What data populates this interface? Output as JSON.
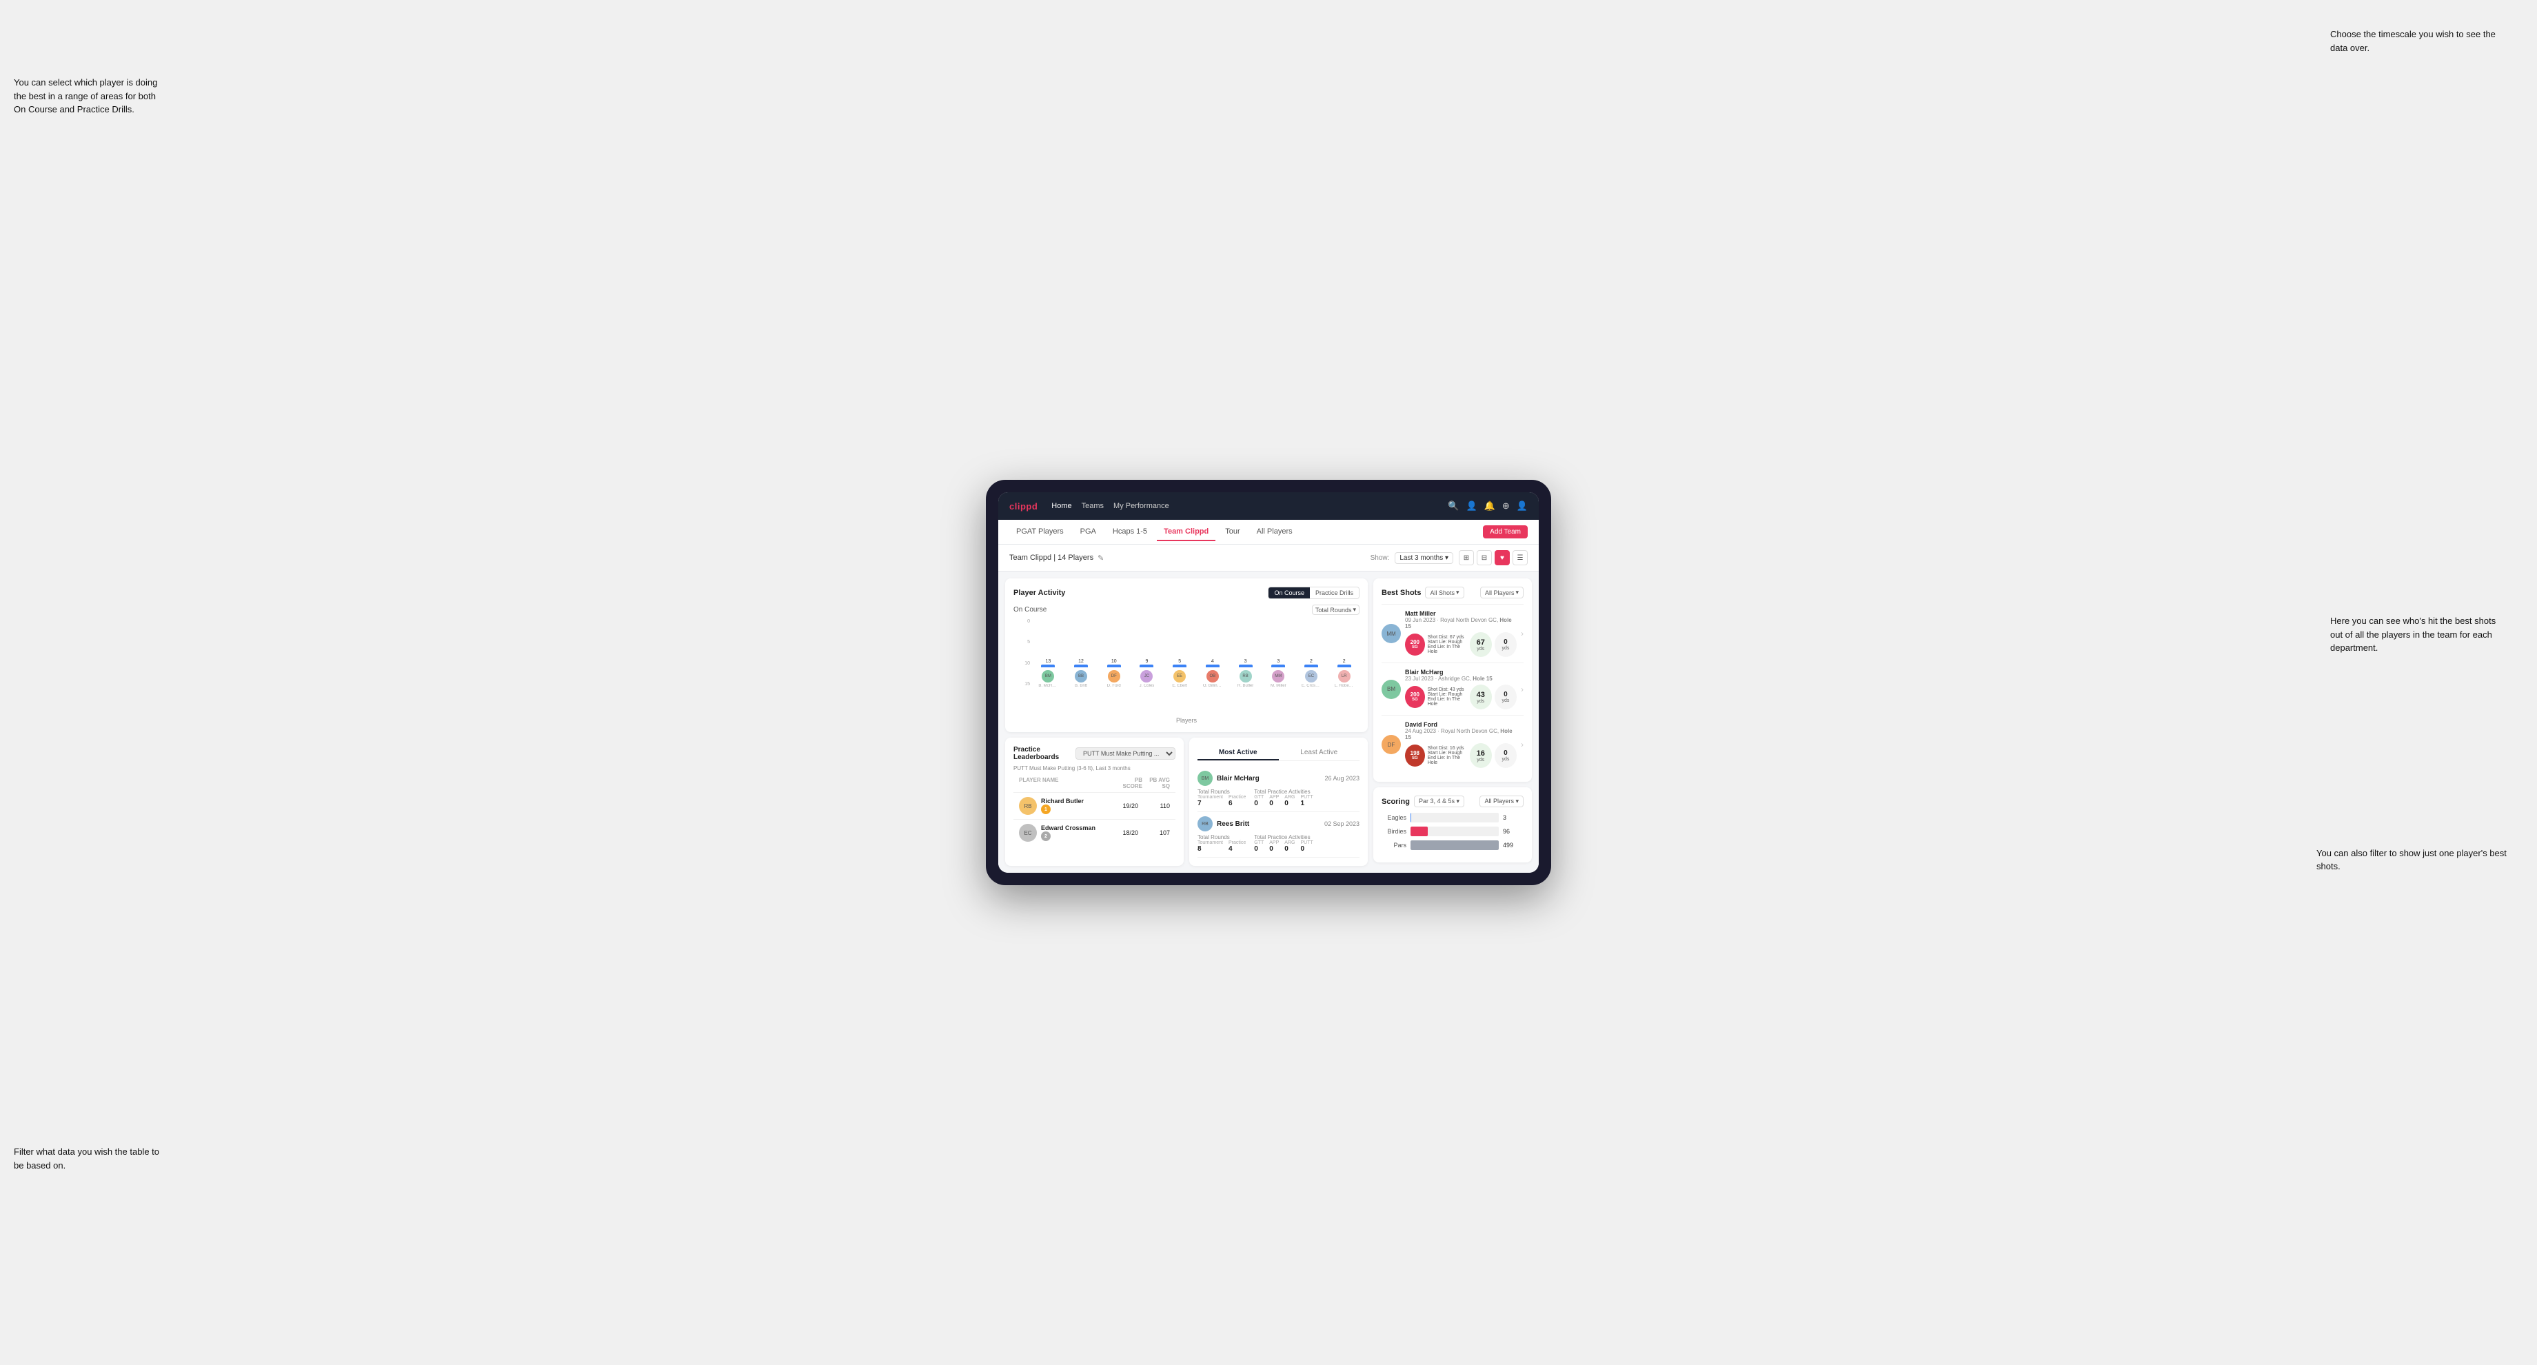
{
  "annotations": {
    "top_right": "Choose the timescale you\nwish to see the data over.",
    "top_left_title": "You can select which player is\ndoing the best in a range of\nareas for both On Course and\nPractice Drills.",
    "bottom_left": "Filter what data you wish the\ntable to be based on.",
    "right_mid": "Here you can see who's hit\nthe best shots out of all the\nplayers in the team for\neach department.",
    "right_bottom": "You can also filter to show\njust one player's best shots."
  },
  "nav": {
    "logo": "clippd",
    "links": [
      "Home",
      "Teams",
      "My Performance"
    ],
    "icons": [
      "search",
      "person",
      "bell",
      "add",
      "user"
    ]
  },
  "sub_nav": {
    "tabs": [
      "PGAT Players",
      "PGA",
      "Hcaps 1-5",
      "Team Clippd",
      "Tour",
      "All Players"
    ],
    "active": "Team Clippd",
    "add_button": "Add Team"
  },
  "team_header": {
    "title": "Team Clippd | 14 Players",
    "edit_icon": "✎",
    "show_label": "Show:",
    "time_select": "Last 3 months",
    "view_icons": [
      "grid",
      "grid2",
      "heart",
      "list"
    ]
  },
  "player_activity": {
    "title": "Player Activity",
    "toggle": [
      "On Course",
      "Practice Drills"
    ],
    "active_toggle": "On Course",
    "section_label": "On Course",
    "chart_dropdown": "Total Rounds",
    "y_labels": [
      "0",
      "5",
      "10",
      "15"
    ],
    "x_title": "Players",
    "y_title": "Total Rounds",
    "bars": [
      {
        "name": "B. McHarg",
        "value": 13,
        "initials": "BM"
      },
      {
        "name": "B. Britt",
        "value": 12,
        "initials": "BB"
      },
      {
        "name": "D. Ford",
        "value": 10,
        "initials": "DF"
      },
      {
        "name": "J. Coles",
        "value": 9,
        "initials": "JC"
      },
      {
        "name": "E. Ebert",
        "value": 5,
        "initials": "EE"
      },
      {
        "name": "O. Billingham",
        "value": 4,
        "initials": "OB"
      },
      {
        "name": "R. Butler",
        "value": 3,
        "initials": "RB"
      },
      {
        "name": "M. Miller",
        "value": 3,
        "initials": "MM"
      },
      {
        "name": "E. Crossman",
        "value": 2,
        "initials": "EC"
      },
      {
        "name": "L. Robertson",
        "value": 2,
        "initials": "LR"
      }
    ]
  },
  "practice_leaderboards": {
    "title": "Practice Leaderboards",
    "dropdown": "PUTT Must Make Putting ...",
    "subtitle": "PUTT Must Make Putting (3-6 ft), Last 3 months",
    "columns": [
      "PLAYER NAME",
      "PB SCORE",
      "PB AVG SQ"
    ],
    "players": [
      {
        "name": "Richard Butler",
        "rank": 1,
        "score": "19/20",
        "avg": "110",
        "initials": "RB"
      },
      {
        "name": "Edward Crossman",
        "rank": 2,
        "score": "18/20",
        "avg": "107",
        "initials": "EC"
      }
    ]
  },
  "most_active": {
    "tabs": [
      "Most Active",
      "Least Active"
    ],
    "active_tab": "Most Active",
    "players": [
      {
        "name": "Blair McHarg",
        "date": "26 Aug 2023",
        "total_rounds_label": "Total Rounds",
        "tournament": "7",
        "practice": "6",
        "total_practice_label": "Total Practice Activities",
        "gtt": "0",
        "app": "0",
        "arg": "0",
        "putt": "1"
      },
      {
        "name": "Rees Britt",
        "date": "02 Sep 2023",
        "total_rounds_label": "Total Rounds",
        "tournament": "8",
        "practice": "4",
        "total_practice_label": "Total Practice Activities",
        "gtt": "0",
        "app": "0",
        "arg": "0",
        "putt": "0"
      }
    ]
  },
  "best_shots": {
    "title": "Best Shots",
    "filter_shots": "All Shots",
    "filter_players": "All Players",
    "players": [
      {
        "name": "Matt Miller",
        "date": "09 Jun 2023",
        "course": "Royal North Devon GC",
        "hole": "Hole 15",
        "badge": "200",
        "badge_sub": "SG",
        "shot_dist_text": "Shot Dist: 67 yds\nStart Lie: Rough\nEnd Lie: In The Hole",
        "dist_val": "67",
        "dist_label": "yds",
        "zero_val": "0",
        "zero_label": "yds",
        "initials": "MM"
      },
      {
        "name": "Blair McHarg",
        "date": "23 Jul 2023",
        "course": "Ashridge GC",
        "hole": "Hole 15",
        "badge": "200",
        "badge_sub": "SG",
        "shot_dist_text": "Shot Dist: 43 yds\nStart Lie: Rough\nEnd Lie: In The Hole",
        "dist_val": "43",
        "dist_label": "yds",
        "zero_val": "0",
        "zero_label": "yds",
        "initials": "BM"
      },
      {
        "name": "David Ford",
        "date": "24 Aug 2023",
        "course": "Royal North Devon GC",
        "hole": "Hole 15",
        "badge": "198",
        "badge_sub": "SG",
        "shot_dist_text": "Shot Dist: 16 yds\nStart Lie: Rough\nEnd Lie: In The Hole",
        "dist_val": "16",
        "dist_label": "yds",
        "zero_val": "0",
        "zero_label": "yds",
        "initials": "DF"
      }
    ]
  },
  "scoring": {
    "title": "Scoring",
    "filter_par": "Par 3, 4 & 5s",
    "filter_players": "All Players",
    "bars": [
      {
        "label": "Eagles",
        "value": 3,
        "max": 500,
        "color": "#3b82f6"
      },
      {
        "label": "Birdies",
        "value": 96,
        "max": 500,
        "color": "#e8365d"
      },
      {
        "label": "Pars",
        "value": 499,
        "max": 500,
        "color": "#6b7280"
      }
    ]
  }
}
